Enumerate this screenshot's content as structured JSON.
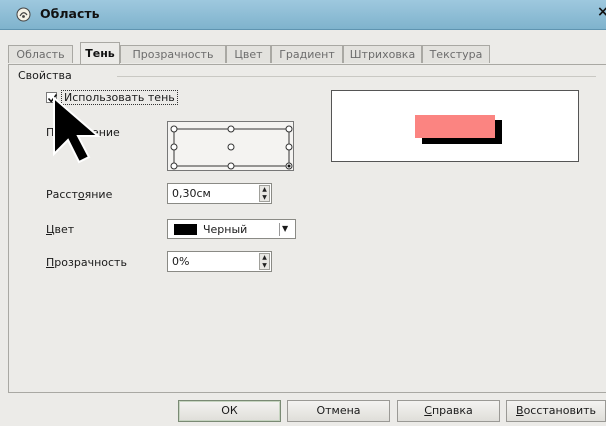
{
  "window": {
    "title": "Область",
    "close_glyph": "×"
  },
  "tabs": [
    {
      "label": "Область",
      "active": false
    },
    {
      "label": "Тень",
      "active": true
    },
    {
      "label": "Прозрачность",
      "active": false
    },
    {
      "label": "Цвет",
      "active": false
    },
    {
      "label": "Градиент",
      "active": false
    },
    {
      "label": "Штриховка",
      "active": false
    },
    {
      "label": "Текстура",
      "active": false
    }
  ],
  "properties": {
    "group_label": "Свойства",
    "use_shadow": {
      "label": "Использовать тень",
      "checked": true
    },
    "position_label": "Положение",
    "position_visible_prefix": "По",
    "position_visible_suffix": "жение",
    "distance": {
      "label_a": "Расст",
      "label_u": "о",
      "label_b": "яние",
      "value": "0,30см"
    },
    "color": {
      "label_u": "Ц",
      "label_b": "вет",
      "value": "Черный",
      "swatch": "#000000"
    },
    "transparency": {
      "label_u": "П",
      "label_b": "розрачность",
      "value": "0%"
    }
  },
  "preview": {
    "object_color": "#fb8481",
    "shadow_color": "#000000"
  },
  "buttons": {
    "ok": "ОК",
    "cancel": "Отмена",
    "help_u": "С",
    "help_b": "правка",
    "reset_u": "В",
    "reset_b": "осстановить"
  }
}
